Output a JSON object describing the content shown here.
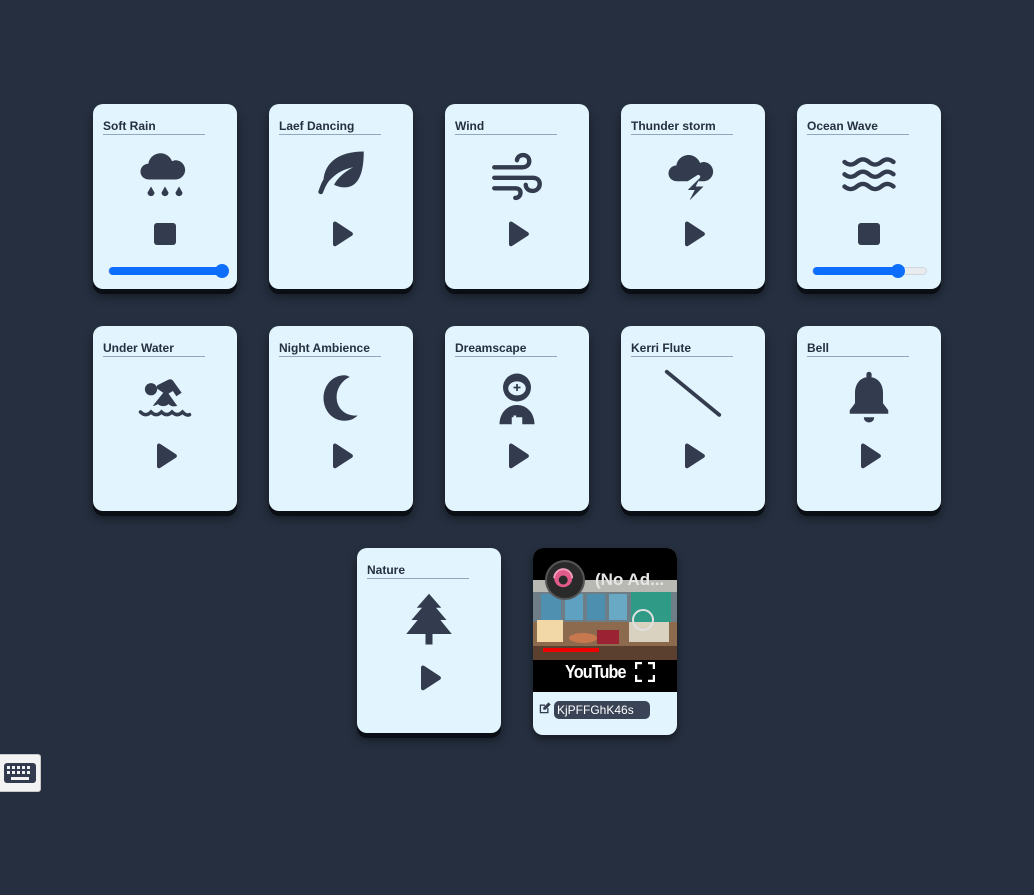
{
  "sounds": [
    {
      "title": "Soft Rain",
      "icon": "cloud-rain-icon",
      "state": "playing",
      "volume": 1.0
    },
    {
      "title": "Laef Dancing",
      "icon": "leaf-icon",
      "state": "stopped"
    },
    {
      "title": "Wind",
      "icon": "wind-icon",
      "state": "stopped"
    },
    {
      "title": "Thunder storm",
      "icon": "cloud-bolt-icon",
      "state": "stopped"
    },
    {
      "title": "Ocean Wave",
      "icon": "water-icon",
      "state": "playing",
      "volume": 0.75
    },
    {
      "title": "Under Water",
      "icon": "person-swimming-icon",
      "state": "stopped"
    },
    {
      "title": "Night Ambience",
      "icon": "moon-icon",
      "state": "stopped"
    },
    {
      "title": "Dreamscape",
      "icon": "user-astronaut-icon",
      "state": "stopped"
    },
    {
      "title": "Kerri Flute",
      "icon": "flute-line-icon",
      "state": "stopped"
    },
    {
      "title": "Bell",
      "icon": "bell-icon",
      "state": "stopped"
    },
    {
      "title": "Nature",
      "icon": "tree-icon",
      "state": "stopped"
    }
  ],
  "youtube": {
    "video_title": "(No Ad...",
    "logo_text": "YouTube",
    "video_id": "KjPFFGhK46s",
    "progress": 0.45
  },
  "colors": {
    "background": "#252f3f",
    "card": "#e2f4fd",
    "icon": "#333c4f",
    "accent": "#0d6efd"
  }
}
